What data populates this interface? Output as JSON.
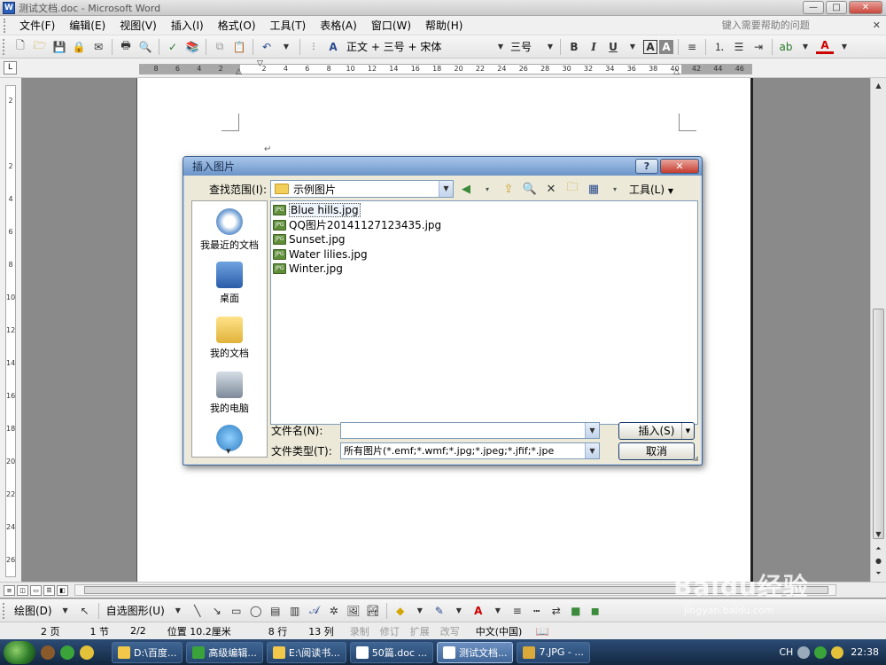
{
  "window": {
    "title": "测试文档.doc - Microsoft Word",
    "min_glyph": "—",
    "max_glyph": "□",
    "close_glyph": "✕"
  },
  "menubar": {
    "items": [
      "文件(F)",
      "编辑(E)",
      "视图(V)",
      "插入(I)",
      "格式(O)",
      "工具(T)",
      "表格(A)",
      "窗口(W)",
      "帮助(H)"
    ],
    "help_placeholder": "键入需要帮助的问题",
    "help_close": "✕"
  },
  "toolbar": {
    "style": "正文 + 三号 + 宋体",
    "font_size": "三号",
    "bold": "B",
    "italic": "I",
    "underline": "U",
    "border_char": "A",
    "shade_char": "A",
    "font_color": "A"
  },
  "ruler": {
    "tab_selector": "L",
    "ticks": [
      "8",
      "6",
      "4",
      "2",
      "",
      "2",
      "4",
      "6",
      "8",
      "10",
      "12",
      "14",
      "16",
      "18",
      "20",
      "22",
      "24",
      "26",
      "28",
      "30",
      "32",
      "34",
      "36",
      "38",
      "40",
      "42",
      "44",
      "46"
    ],
    "vticks": [
      "2",
      "",
      "2",
      "4",
      "6",
      "8",
      "10",
      "12",
      "14",
      "16",
      "18",
      "20",
      "22",
      "24",
      "26"
    ]
  },
  "dialog": {
    "title": "插入图片",
    "help": "?",
    "close": "✕",
    "look_in_label": "查找范围(I):",
    "look_in_value": "示例图片",
    "tools_label": "工具(L)",
    "places": [
      "我最近的文档",
      "桌面",
      "我的文档",
      "我的电脑"
    ],
    "files": [
      {
        "name": "Blue hills.jpg",
        "selected": true
      },
      {
        "name": "QQ图片20141127123435.jpg",
        "selected": false
      },
      {
        "name": "Sunset.jpg",
        "selected": false
      },
      {
        "name": "Water lilies.jpg",
        "selected": false
      },
      {
        "name": "Winter.jpg",
        "selected": false
      }
    ],
    "file_name_label": "文件名(N):",
    "file_name_value": "",
    "file_type_label": "文件类型(T):",
    "file_type_value": "所有图片(*.emf;*.wmf;*.jpg;*.jpeg;*.jfif;*.jpe",
    "insert_button": "插入(S)",
    "cancel_button": "取消",
    "jpg_icon_text": "JPG"
  },
  "drawbar": {
    "draw_label": "绘图(D)",
    "autoshapes_label": "自选图形(U)"
  },
  "status": {
    "page": "2 页",
    "section": "1 节",
    "pages": "2/2",
    "position": "位置 10.2厘米",
    "line": "8 行",
    "column": "13 列",
    "rec": "录制",
    "trk": "修订",
    "ext": "扩展",
    "ovr": "改写",
    "language": "中文(中国)"
  },
  "taskbar": {
    "items": [
      {
        "label": "D:\\百度...",
        "active": false
      },
      {
        "label": "高级编辑...",
        "active": false
      },
      {
        "label": "E:\\阅读书...",
        "active": false
      },
      {
        "label": "50篇.doc ...",
        "active": false
      },
      {
        "label": "测试文档...",
        "active": true
      },
      {
        "label": "7.JPG - ...",
        "active": false
      }
    ],
    "input_indicator": "CH",
    "clock": "22:38"
  },
  "watermark": {
    "main": "Baidu经验",
    "sub": "jingyan.baidu.com"
  }
}
